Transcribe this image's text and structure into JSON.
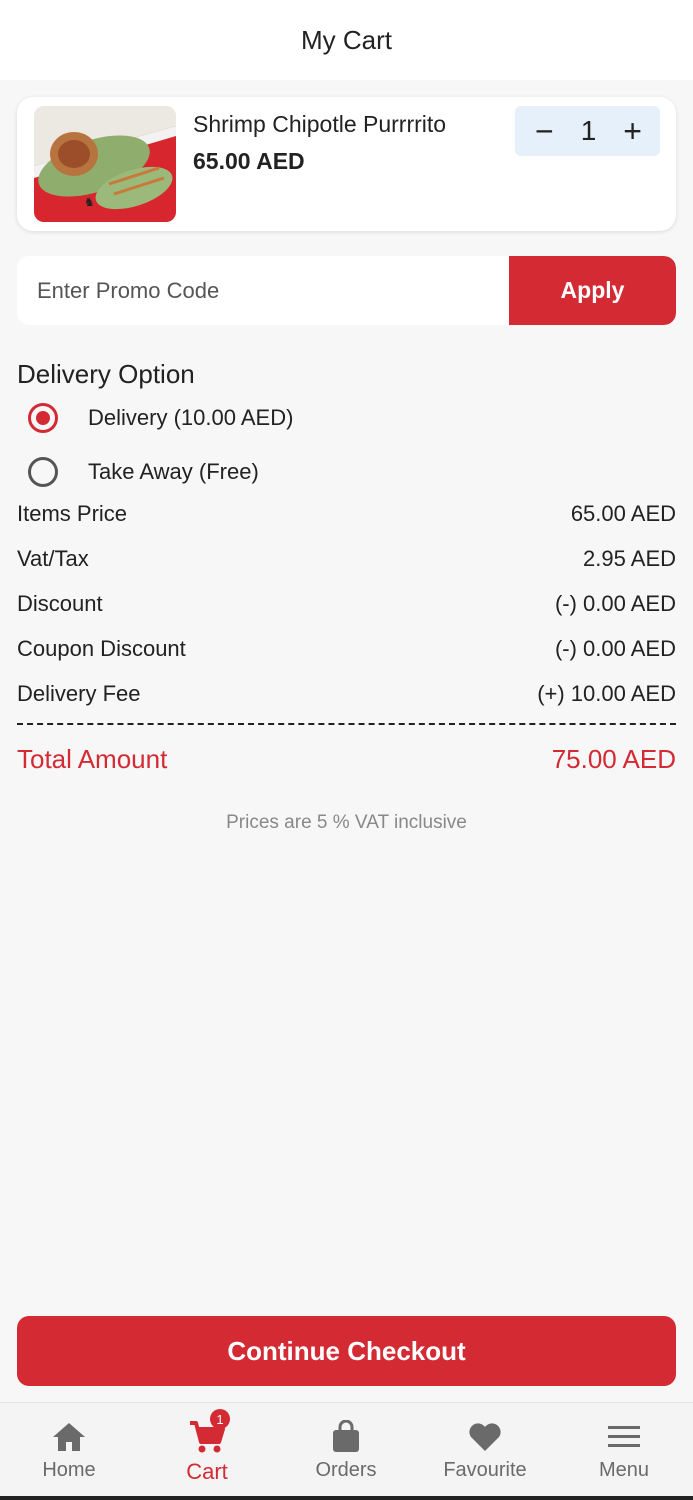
{
  "header": {
    "title": "My Cart"
  },
  "cart_item": {
    "name": "Shrimp Chipotle Purrrrito",
    "price": "65.00 AED",
    "quantity": "1",
    "minus_label": "−",
    "plus_label": "+"
  },
  "promo": {
    "placeholder": "Enter Promo Code",
    "apply_label": "Apply"
  },
  "delivery": {
    "title": "Delivery Option",
    "options": [
      {
        "label": "Delivery (10.00 AED)",
        "selected": true
      },
      {
        "label": "Take Away (Free)",
        "selected": false
      }
    ]
  },
  "summary": {
    "rows": [
      {
        "label": "Items Price",
        "value": "65.00 AED"
      },
      {
        "label": "Vat/Tax",
        "value": "2.95 AED"
      },
      {
        "label": "Discount",
        "value": "(-) 0.00 AED"
      },
      {
        "label": "Coupon Discount",
        "value": "(-) 0.00 AED"
      },
      {
        "label": "Delivery Fee",
        "value": "(+) 10.00 AED"
      }
    ],
    "total_label": "Total Amount",
    "total_value": "75.00 AED",
    "vat_note": "Prices are 5 % VAT inclusive"
  },
  "checkout_label": "Continue Checkout",
  "nav": {
    "items": [
      {
        "label": "Home",
        "icon": "home-icon"
      },
      {
        "label": "Cart",
        "icon": "cart-icon",
        "badge": "1",
        "active": true
      },
      {
        "label": "Orders",
        "icon": "bag-icon"
      },
      {
        "label": "Favourite",
        "icon": "heart-icon"
      },
      {
        "label": "Menu",
        "icon": "menu-icon"
      }
    ]
  },
  "colors": {
    "accent": "#d32a34",
    "qty_bg": "#e6f0fa",
    "background": "#f7f7f7"
  }
}
